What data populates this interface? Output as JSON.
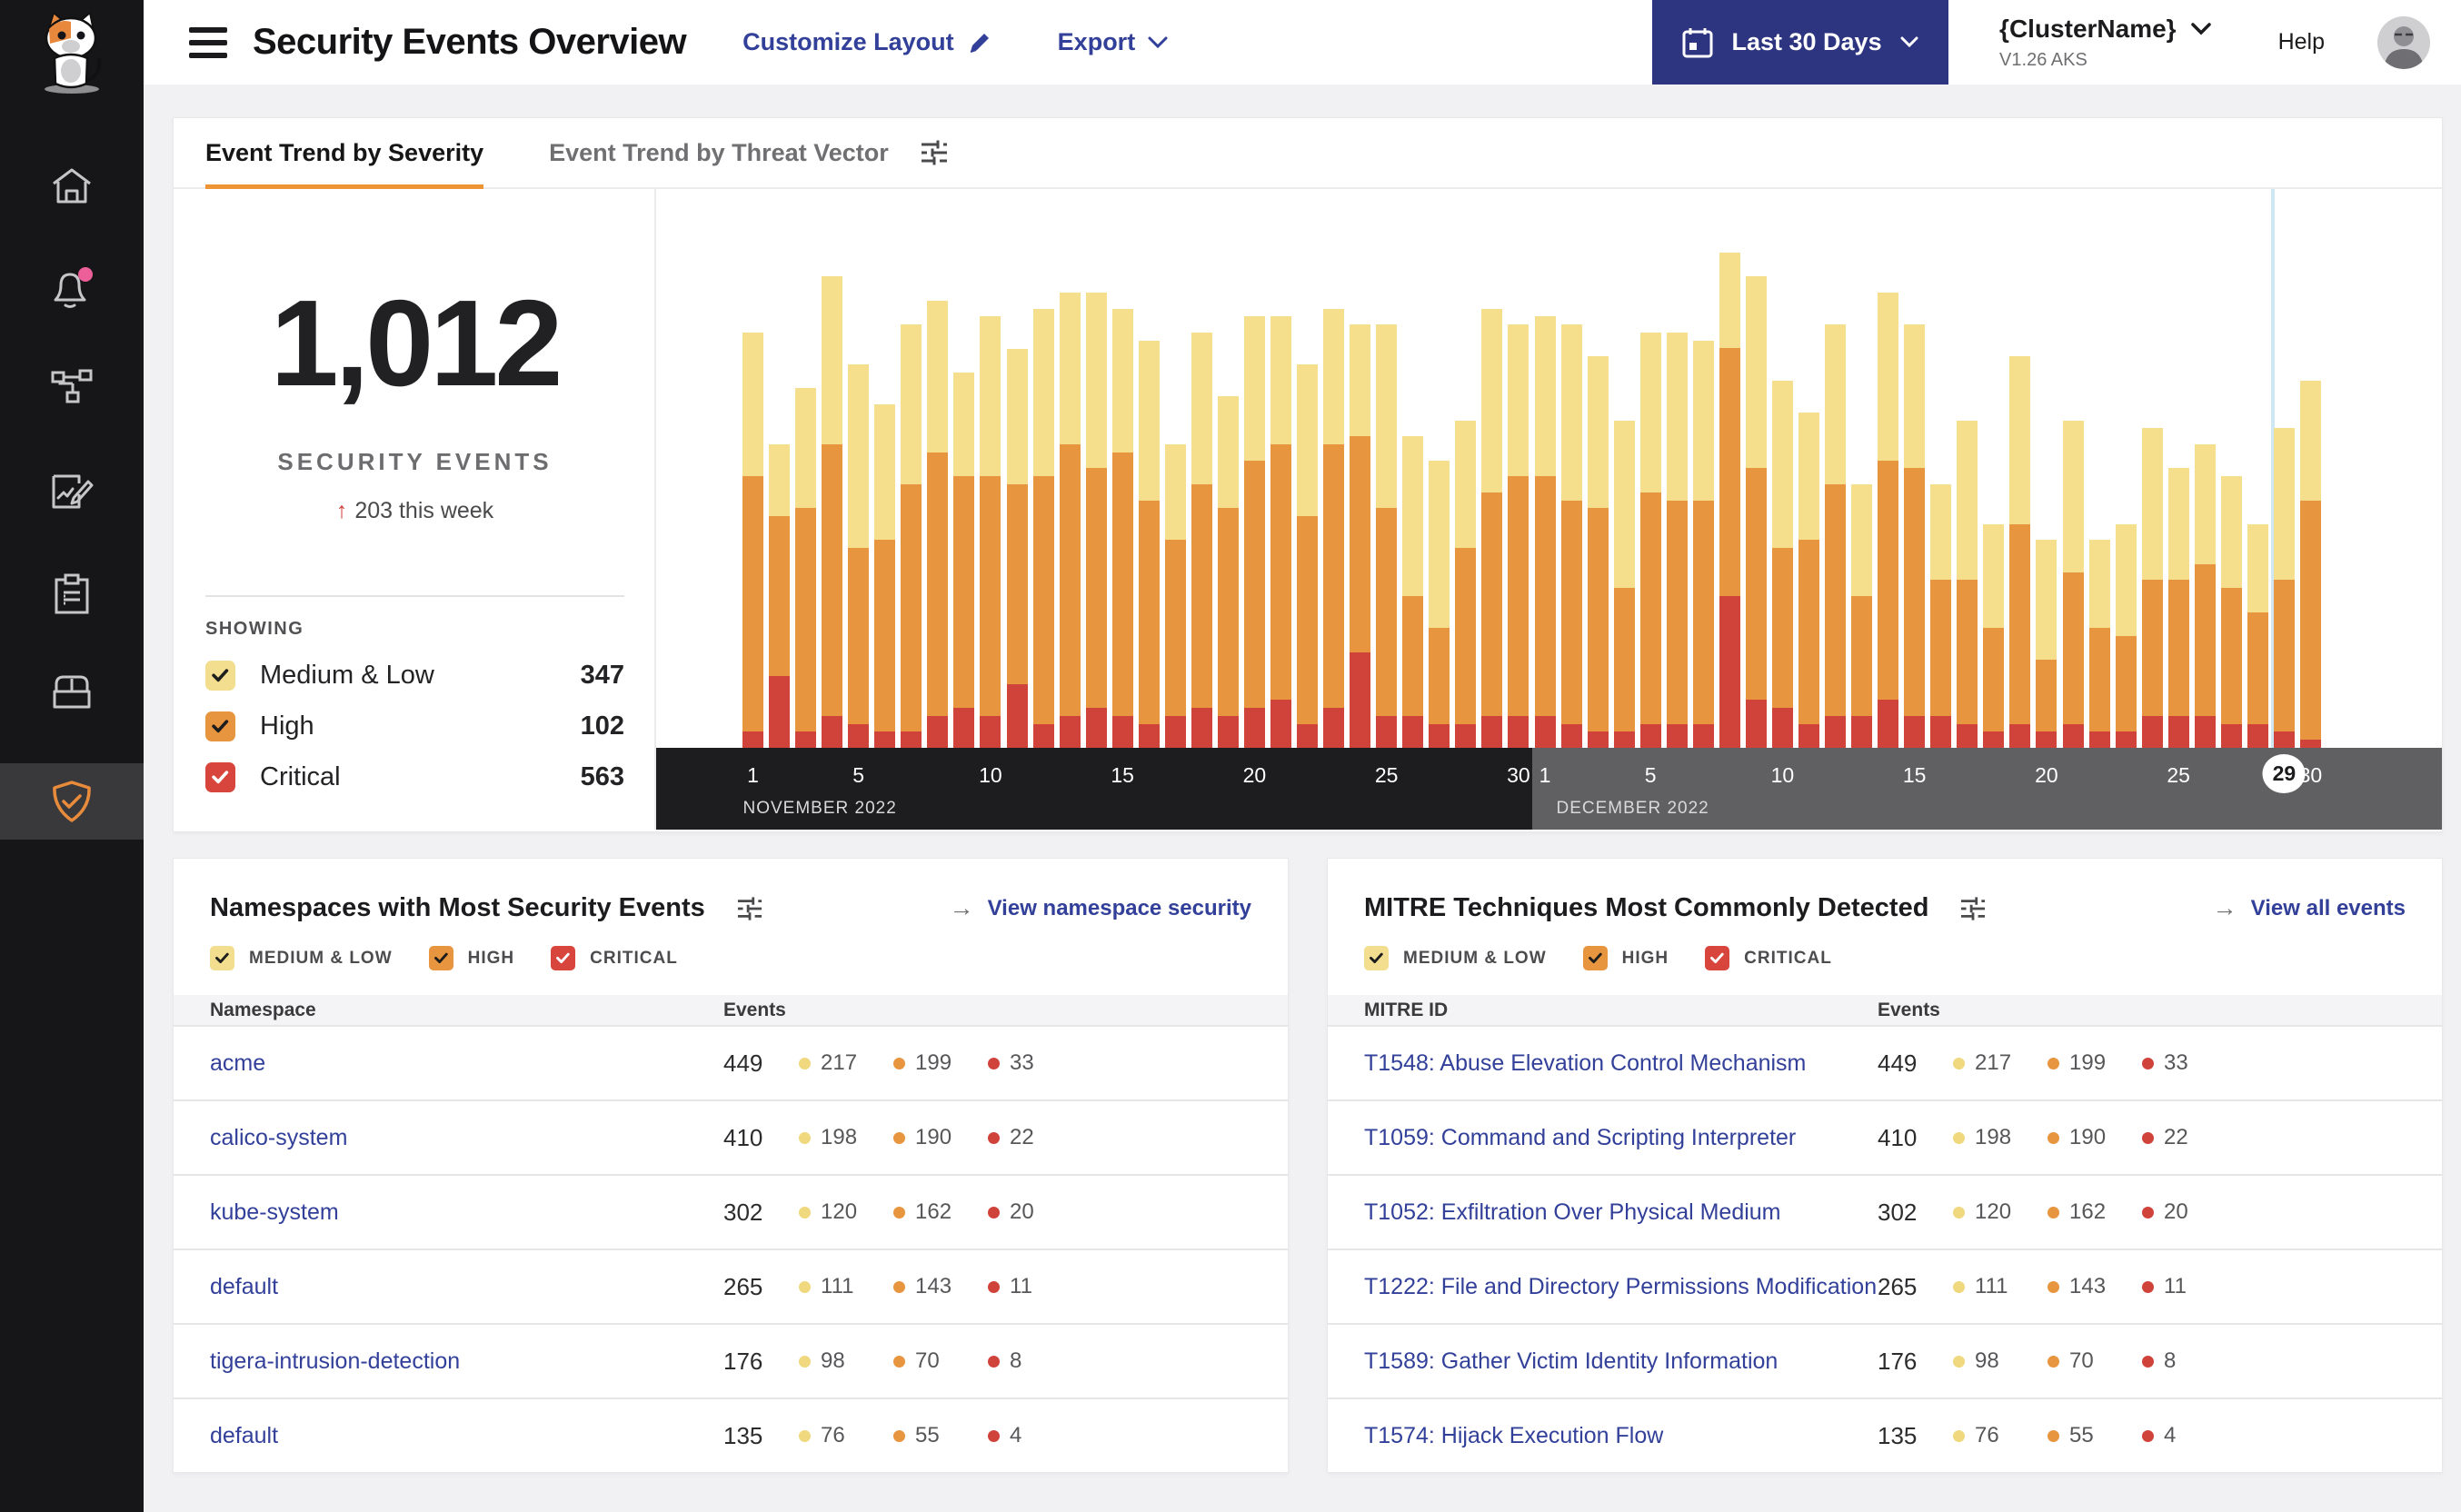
{
  "header": {
    "title": "Security Events Overview",
    "customize_layout": "Customize Layout",
    "export_label": "Export",
    "date_range": "Last 30 Days",
    "cluster_name": "{ClusterName}",
    "cluster_version": "V1.26 AKS",
    "help": "Help"
  },
  "sidebar": {
    "items": [
      "calico-cat-logo",
      "home",
      "alerts-bell",
      "service-graph",
      "policies-edit",
      "compliance-clipboard",
      "image-assurance-box",
      "threat-defense-shield"
    ]
  },
  "tabs": [
    {
      "label": "Event Trend by Severity",
      "active": true
    },
    {
      "label": "Event Trend by Threat Vector",
      "active": false
    }
  ],
  "summary": {
    "total": "1,012",
    "subtitle": "SECURITY EVENTS",
    "delta_arrow": "↑",
    "delta": "203 this week",
    "showing_label": "SHOWING",
    "legend": [
      {
        "label": "Medium & Low",
        "value": "347",
        "color": "#F2DE8E",
        "check": "#1d1d1d"
      },
      {
        "label": "High",
        "value": "102",
        "color": "#E8953F",
        "check": "#1d1d1d"
      },
      {
        "label": "Critical",
        "value": "563",
        "color": "#D8453C",
        "check": "#ffffff"
      }
    ]
  },
  "severity_filters": [
    {
      "label": "MEDIUM & LOW",
      "color": "#F2DE8E",
      "check": "#1d1d1d"
    },
    {
      "label": "HIGH",
      "color": "#E8953F",
      "check": "#1d1d1d"
    },
    {
      "label": "CRITICAL",
      "color": "#D8453C",
      "check": "#ffffff"
    }
  ],
  "severity_colors": {
    "medium": "#EFD87D",
    "high": "#E8953F",
    "critical": "#D0433B"
  },
  "chart_data": {
    "type": "stacked_bar",
    "note": "Daily security events by severity; values estimated from bar heights (no numeric y-axis shown).",
    "x_months": [
      {
        "label": "NOVEMBER 2022",
        "days": 30,
        "ticks": [
          1,
          5,
          10,
          15,
          20,
          25,
          30
        ]
      },
      {
        "label": "DECEMBER 2022",
        "days": 30,
        "ticks": [
          1,
          5,
          10,
          15,
          20,
          25,
          30
        ]
      }
    ],
    "highlight": {
      "month_index": 1,
      "day": 29
    },
    "legend_position": "left-panel",
    "grid": false,
    "series": [
      {
        "name": "Critical",
        "color": "#D0433B",
        "values": [
          2,
          9,
          2,
          4,
          3,
          2,
          2,
          4,
          5,
          4,
          8,
          3,
          4,
          5,
          4,
          3,
          4,
          5,
          4,
          5,
          6,
          3,
          5,
          12,
          4,
          4,
          3,
          3,
          4,
          4,
          4,
          3,
          2,
          2,
          3,
          3,
          3,
          19,
          6,
          5,
          3,
          4,
          4,
          6,
          4,
          4,
          3,
          2,
          3,
          2,
          3,
          2,
          2,
          4,
          4,
          4,
          3,
          3,
          2,
          1
        ]
      },
      {
        "name": "High",
        "color": "#E8953F",
        "values": [
          32,
          20,
          28,
          34,
          22,
          24,
          31,
          33,
          29,
          30,
          25,
          31,
          34,
          30,
          33,
          28,
          22,
          28,
          26,
          31,
          32,
          26,
          33,
          27,
          26,
          15,
          12,
          22,
          28,
          30,
          30,
          28,
          28,
          18,
          29,
          28,
          28,
          31,
          29,
          20,
          23,
          29,
          15,
          30,
          31,
          17,
          18,
          13,
          25,
          9,
          19,
          13,
          12,
          17,
          17,
          19,
          17,
          14,
          19,
          30
        ]
      },
      {
        "name": "Medium & Low",
        "color": "#F5DF8D",
        "values": [
          18,
          9,
          15,
          21,
          23,
          17,
          20,
          19,
          13,
          20,
          17,
          21,
          19,
          22,
          18,
          20,
          12,
          19,
          14,
          18,
          16,
          19,
          17,
          14,
          23,
          20,
          21,
          16,
          23,
          19,
          20,
          22,
          19,
          21,
          20,
          21,
          20,
          12,
          24,
          21,
          16,
          20,
          14,
          21,
          18,
          12,
          20,
          13,
          21,
          15,
          19,
          11,
          14,
          19,
          14,
          15,
          14,
          11,
          19,
          15
        ]
      }
    ]
  },
  "namespaces_card": {
    "title": "Namespaces with Most Security Events",
    "link_label": "View namespace security",
    "link_arrow": "→",
    "columns": [
      "Namespace",
      "Events"
    ],
    "rows": [
      {
        "name": "acme",
        "total": "449",
        "medium": "217",
        "high": "199",
        "critical": "33"
      },
      {
        "name": "calico-system",
        "total": "410",
        "medium": "198",
        "high": "190",
        "critical": "22"
      },
      {
        "name": "kube-system",
        "total": "302",
        "medium": "120",
        "high": "162",
        "critical": "20"
      },
      {
        "name": "default",
        "total": "265",
        "medium": "111",
        "high": "143",
        "critical": "11"
      },
      {
        "name": "tigera-intrusion-detection",
        "total": "176",
        "medium": "98",
        "high": "70",
        "critical": "8"
      },
      {
        "name": "default",
        "total": "135",
        "medium": "76",
        "high": "55",
        "critical": "4"
      }
    ]
  },
  "mitre_card": {
    "title": "MITRE Techniques Most Commonly Detected",
    "link_label": "View all events",
    "link_arrow": "→",
    "columns": [
      "MITRE ID",
      "Events"
    ],
    "rows": [
      {
        "name": "T1548: Abuse Elevation Control Mechanism",
        "total": "449",
        "medium": "217",
        "high": "199",
        "critical": "33"
      },
      {
        "name": "T1059: Command and Scripting Interpreter",
        "total": "410",
        "medium": "198",
        "high": "190",
        "critical": "22"
      },
      {
        "name": "T1052: Exfiltration Over Physical Medium",
        "total": "302",
        "medium": "120",
        "high": "162",
        "critical": "20"
      },
      {
        "name": "T1222: File and Directory Permissions Modification",
        "total": "265",
        "medium": "111",
        "high": "143",
        "critical": "11"
      },
      {
        "name": "T1589: Gather Victim Identity Information",
        "total": "176",
        "medium": "98",
        "high": "70",
        "critical": "8"
      },
      {
        "name": "T1574: Hijack Execution Flow",
        "total": "135",
        "medium": "76",
        "high": "55",
        "critical": "4"
      }
    ]
  }
}
